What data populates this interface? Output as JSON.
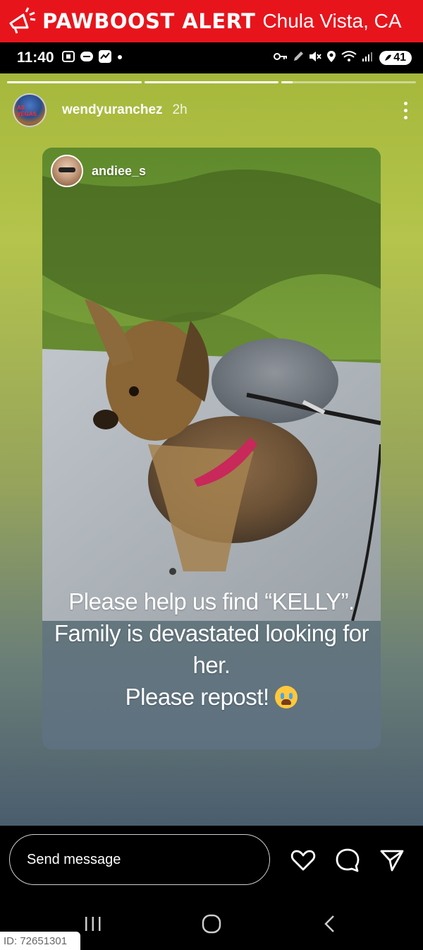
{
  "alert": {
    "title": "PAWBOOST ALERT",
    "location": "Chula Vista, CA",
    "icon": "megaphone-icon",
    "bg_color": "#e8141c"
  },
  "status_bar": {
    "time": "11:40",
    "battery": "41"
  },
  "story": {
    "progress": [
      1.0,
      1.0,
      0.08
    ],
    "username": "wendyuranchez",
    "time_ago": "2h",
    "avatar_text": "AS VEGAS",
    "repost": {
      "username": "andiee_s",
      "caption_lines": [
        "Please help us find “KELLY”.",
        "Family is devastated looking for",
        "her.",
        "Please repost!"
      ],
      "caption_emoji": "loudly-crying-face"
    }
  },
  "bottom": {
    "message_placeholder": "Send message"
  },
  "watermark": {
    "id_text": "ID: 72651301"
  }
}
